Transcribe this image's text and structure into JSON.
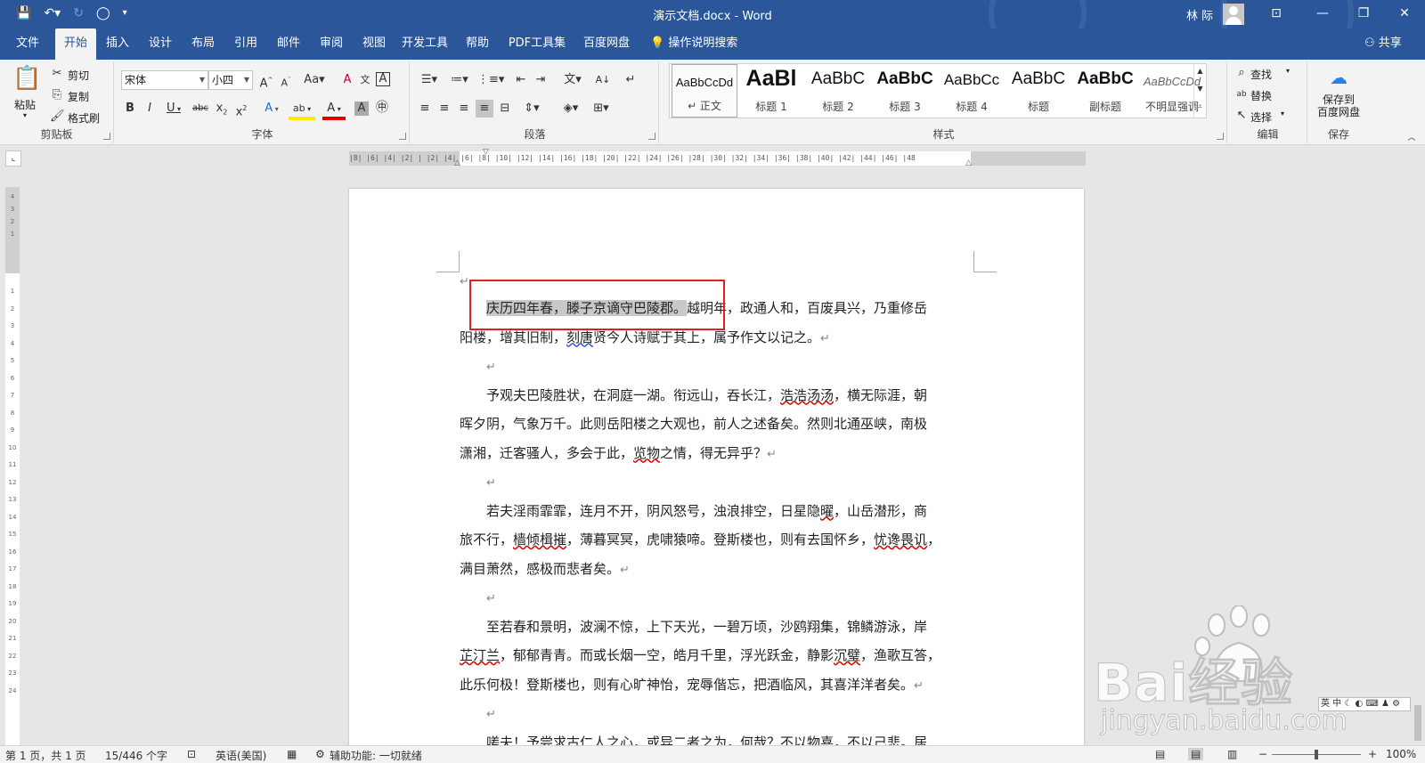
{
  "titlebar": {
    "doc_title": "演示文档.docx  -  Word",
    "user": "林 际",
    "qat": {
      "save": "save-icon",
      "undo": "undo-icon",
      "redo": "redo-icon",
      "circle": "circle-icon"
    }
  },
  "tabs": [
    "文件",
    "开始",
    "插入",
    "设计",
    "布局",
    "引用",
    "邮件",
    "审阅",
    "视图",
    "开发工具",
    "帮助",
    "PDF工具集",
    "百度网盘"
  ],
  "tell_me": "操作说明搜索",
  "share": "共享",
  "ribbon": {
    "clipboard": {
      "paste": "粘贴",
      "cut": "剪切",
      "copy": "复制",
      "format_painter": "格式刷",
      "label": "剪贴板"
    },
    "font": {
      "name": "宋体",
      "size": "小四",
      "label": "字体"
    },
    "paragraph": {
      "label": "段落"
    },
    "styles": {
      "label": "样式",
      "items": [
        {
          "preview": "AaBbCcDd",
          "name": "↵ 正文"
        },
        {
          "preview": "AaBl",
          "name": "标题 1"
        },
        {
          "preview": "AaBbC",
          "name": "标题 2"
        },
        {
          "preview": "AaBbC",
          "name": "标题 3"
        },
        {
          "preview": "AaBbCc",
          "name": "标题 4"
        },
        {
          "preview": "AaBbC",
          "name": "标题"
        },
        {
          "preview": "AaBbC",
          "name": "副标题"
        },
        {
          "preview": "AaBbCcDd",
          "name": "不明显强调"
        }
      ]
    },
    "editing": {
      "find": "查找",
      "replace": "替换",
      "select": "选择",
      "label": "编辑"
    },
    "save": {
      "button": "保存到\n百度网盘",
      "label": "保存"
    }
  },
  "ruler": {
    "h_numbers": "|8|  |6|  |4|  |2|  |  |2|  |4|  |6|  |8|  |10|  |12|  |14|  |16|  |18|  |20|  |22|  |24|  |26|  |28|  |30|  |32|  |34|  |36|  |38|  |40|  |42|  |44|  |46|  |48",
    "v_numbers": [
      "4",
      "3",
      "2",
      "1",
      "",
      "1",
      "2",
      "3",
      "4",
      "5",
      "6",
      "7",
      "8",
      "9",
      "10",
      "11",
      "12",
      "13",
      "14",
      "15",
      "16",
      "17",
      "18",
      "19",
      "20",
      "21",
      "22",
      "23",
      "24"
    ]
  },
  "document": {
    "p1_l1_sel": "庆历四年春，滕子京谪守巴陵郡。",
    "p1_l1_rest": "越明年，政通人和，百废具兴，乃重修岳",
    "p1_l2_a": "阳楼，增其旧制，",
    "p1_l2_b": "刻唐",
    "p1_l2_c": "贤今人诗赋于其上，属予作文以记之。",
    "p2_l1_a": "予观夫巴陵胜状，在洞庭一湖。衔远山，吞长江，",
    "p2_l1_b": "浩浩汤汤",
    "p2_l1_c": "，横无际涯，朝",
    "p2_l2": "晖夕阴，气象万千。此则岳阳楼之大观也，前人之述备矣。然则北通巫峡，南极",
    "p2_l3_a": "潇湘，迁客骚人，多会于此，",
    "p2_l3_b": "览物",
    "p2_l3_c": "之情，得无异乎？",
    "p3_l1_a": "若夫淫雨霏霏，连月不开，阴风怒号，浊浪排空，日星隐",
    "p3_l1_b": "曜",
    "p3_l1_c": "，山岳潜形，商",
    "p3_l2_a": "旅不行，",
    "p3_l2_b": "樯倾楫摧",
    "p3_l2_c": "，薄暮冥冥，虎啸猿啼。登斯楼也，则有去国怀乡，",
    "p3_l2_d": "忧谗畏讥",
    "p3_l2_e": "，",
    "p3_l3": "满目萧然，感极而悲者矣。",
    "p4_l1": "至若春和景明，波澜不惊，上下天光，一碧万顷，沙鸥翔集，锦鳞游泳，岸",
    "p4_l2_a": "芷汀兰",
    "p4_l2_b": "，郁郁青青。而或长烟一空，皓月千里，浮光跃金，静影",
    "p4_l2_c": "沉璧",
    "p4_l2_d": "，渔歌互答，",
    "p4_l3": "此乐何极！登斯楼也，则有心旷神怡，宠辱偕忘，把酒临风，其喜洋洋者矣。",
    "p5_l1": "嗟夫！予尝求古仁人之心，或异二者之为，何哉？不以物喜，不以己悲。居",
    "para_mark": "↵"
  },
  "statusbar": {
    "page": "第 1 页，共 1 页",
    "words": "15/446 个字",
    "language": "英语(美国)",
    "accessibility": "辅助功能: 一切就绪",
    "zoom": "100%"
  },
  "ime": "英 中 ☾ ◐ ⌨ ♟ ⚙",
  "watermark": {
    "main": "Bai经验",
    "sub": "jingyan.baidu.com"
  },
  "colors": {
    "brand": "#2b579a",
    "annotation": "#e02020",
    "selection": "#c8c8c8",
    "ribbon": "#f3f3f3"
  }
}
